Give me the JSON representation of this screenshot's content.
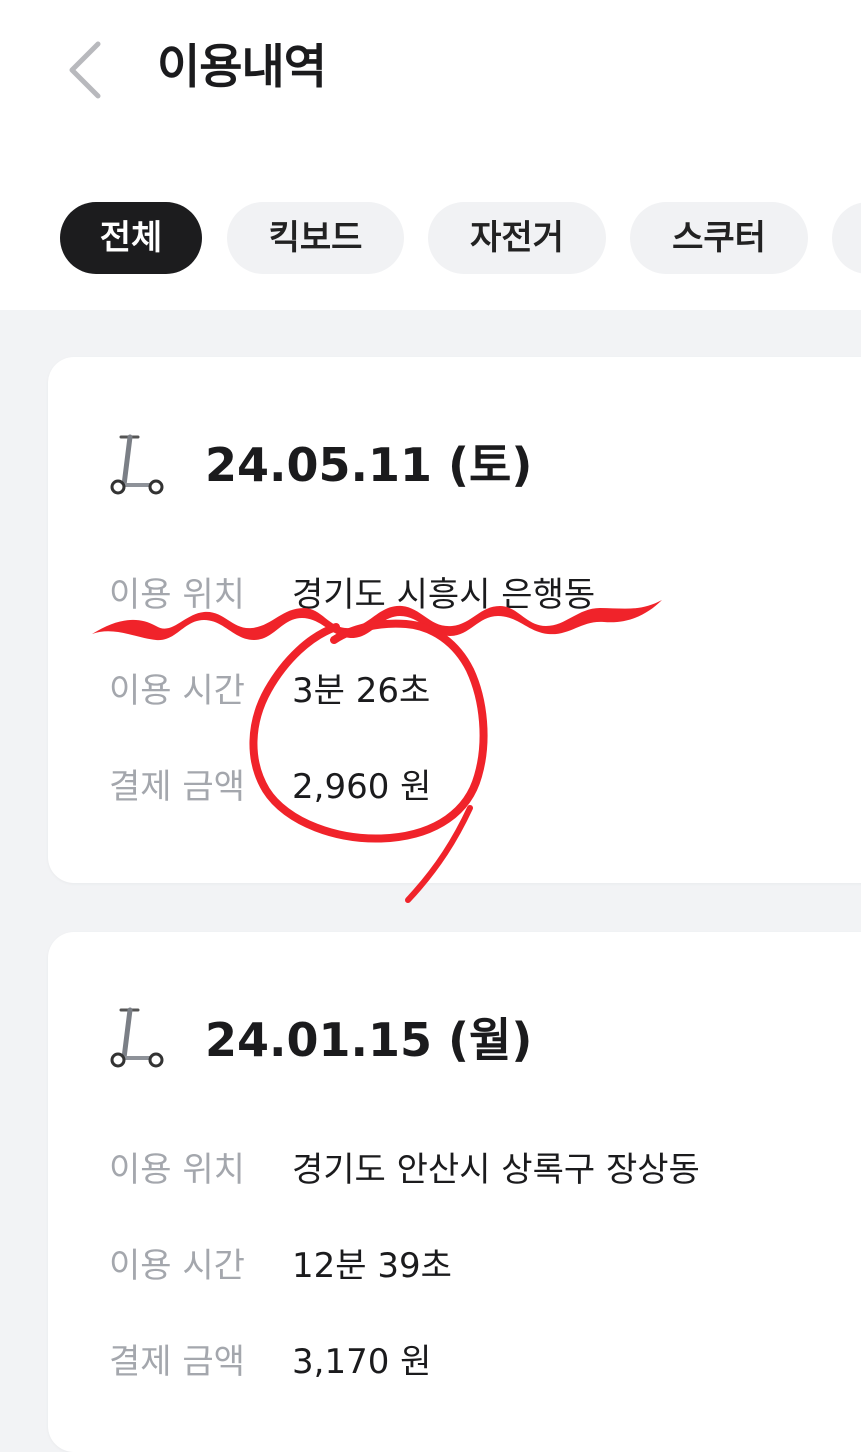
{
  "header": {
    "title": "이용내역",
    "back_icon": "chevron-left-icon"
  },
  "tabs": [
    {
      "label": "전체",
      "active": true
    },
    {
      "label": "킥보드",
      "active": false
    },
    {
      "label": "자전거",
      "active": false
    },
    {
      "label": "스쿠터",
      "active": false
    }
  ],
  "records": [
    {
      "icon": "kick-scooter-icon",
      "date": "24.05.11 (토)",
      "rows": [
        {
          "label": "이용 위치",
          "value": "경기도 시흥시 은행동"
        },
        {
          "label": "이용 시간",
          "value": "3분 26초"
        },
        {
          "label": "결제 금액",
          "value": "2,960 원"
        }
      ]
    },
    {
      "icon": "kick-scooter-icon",
      "date": "24.01.15 (월)",
      "rows": [
        {
          "label": "이용 위치",
          "value": "경기도 안산시 상록구 장상동"
        },
        {
          "label": "이용 시간",
          "value": "12분 39초"
        },
        {
          "label": "결제 금액",
          "value": "3,170 원"
        }
      ]
    }
  ],
  "colors": {
    "background": "#f2f3f5",
    "active_tab": "#1c1c1e",
    "inactive_tab": "#f1f2f4",
    "label_gray": "#a4a7ad",
    "annotation_red": "#f0232a"
  }
}
